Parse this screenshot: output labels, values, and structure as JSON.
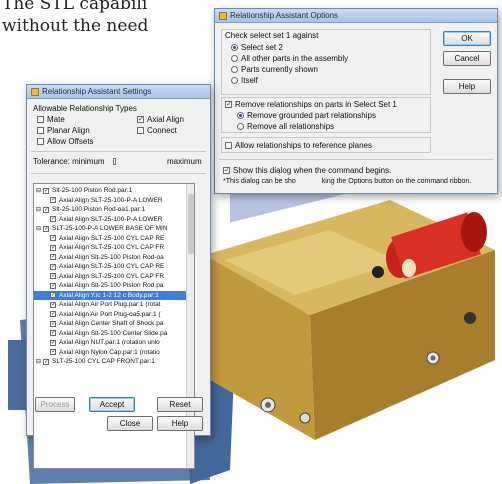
{
  "article": {
    "line1": "The STL capabili",
    "line2": "without the need"
  },
  "options_dialog": {
    "title": "Relationship Assistant Options",
    "group1_heading": "Check select set 1 against",
    "radios": [
      {
        "label": "Select set 2",
        "selected": true
      },
      {
        "label": "All other parts in the assembly",
        "selected": false
      },
      {
        "label": "Parts currently shown",
        "selected": false
      },
      {
        "label": "Itself",
        "selected": false
      }
    ],
    "remove_checkbox": "Remove relationships on parts in Select Set 1",
    "remove_checked": true,
    "remove_radios": [
      {
        "label": "Remove grounded part relationships",
        "selected": true
      },
      {
        "label": "Remove all relationships",
        "selected": false
      }
    ],
    "allow_ref_planes": "Allow relationships to reference planes",
    "allow_ref_checked": false,
    "show_dialog": "Show this dialog when the command begins.",
    "show_dialog_checked": true,
    "note": "*This dialog can be sho",
    "note_tail": "king the Options button on the command ribbon.",
    "ok": "OK",
    "cancel": "Cancel",
    "help": "Help"
  },
  "settings_dialog": {
    "title": "Relationship Assistant Settings",
    "allowable_heading": "Allowable Relationship Types",
    "types": [
      {
        "label": "Mate",
        "checked": false
      },
      {
        "label": "Axial Align",
        "checked": true
      },
      {
        "label": "Planar Align",
        "checked": false
      },
      {
        "label": "Connect",
        "checked": false
      },
      {
        "label": "Allow Offsets",
        "checked": false
      }
    ],
    "tolerance_label": "Tolerance:  minimum",
    "tolerance_max": "maximum",
    "tree": [
      "Slt-25-100 Piston Rod.par:1",
      "Axial Align SLT-25-100-P-A LOWER",
      "Slt-25-100 Piston Rod-oa1.par:1",
      "Axial Align SLT-25-100-P-A LOWER",
      "SLT-25-100-P-A LOWER BASE OF MIN",
      "Axial Align SLT-25-100 CYL CAP RE",
      "Axial Align SLT-25-100 CYL CAP FR",
      "Axial Align Slt-25-100 Piston Rod-oa",
      "Axial Align SLT-25-100 CYL CAP RE",
      "Axial Align SLT-25-100 CYL CAP FR",
      "Axial Align Slt-25-100 Piston Rod.pa",
      "Axial Align Y.ic 1-2 12 c Body.par:1",
      "Axial Align Air Port Plug.par:1   (rotat",
      "Axial Align Air Port Plug-oa5.par:1   (",
      "Axial Align Center Shaft of Shock.pa",
      "Axial Align Slt-25-100 Center Slide.pa",
      "Axial Align NUT.par:1   (rotation unlo",
      "Axial Align Nylon Cap.par:1   (rotatio",
      "SLT-25-100 CYL CAP FRONT.par:1"
    ],
    "selected_index": 11,
    "process": "Process",
    "accept": "Accept",
    "reset": "Reset",
    "close": "Close",
    "help": "Help"
  }
}
